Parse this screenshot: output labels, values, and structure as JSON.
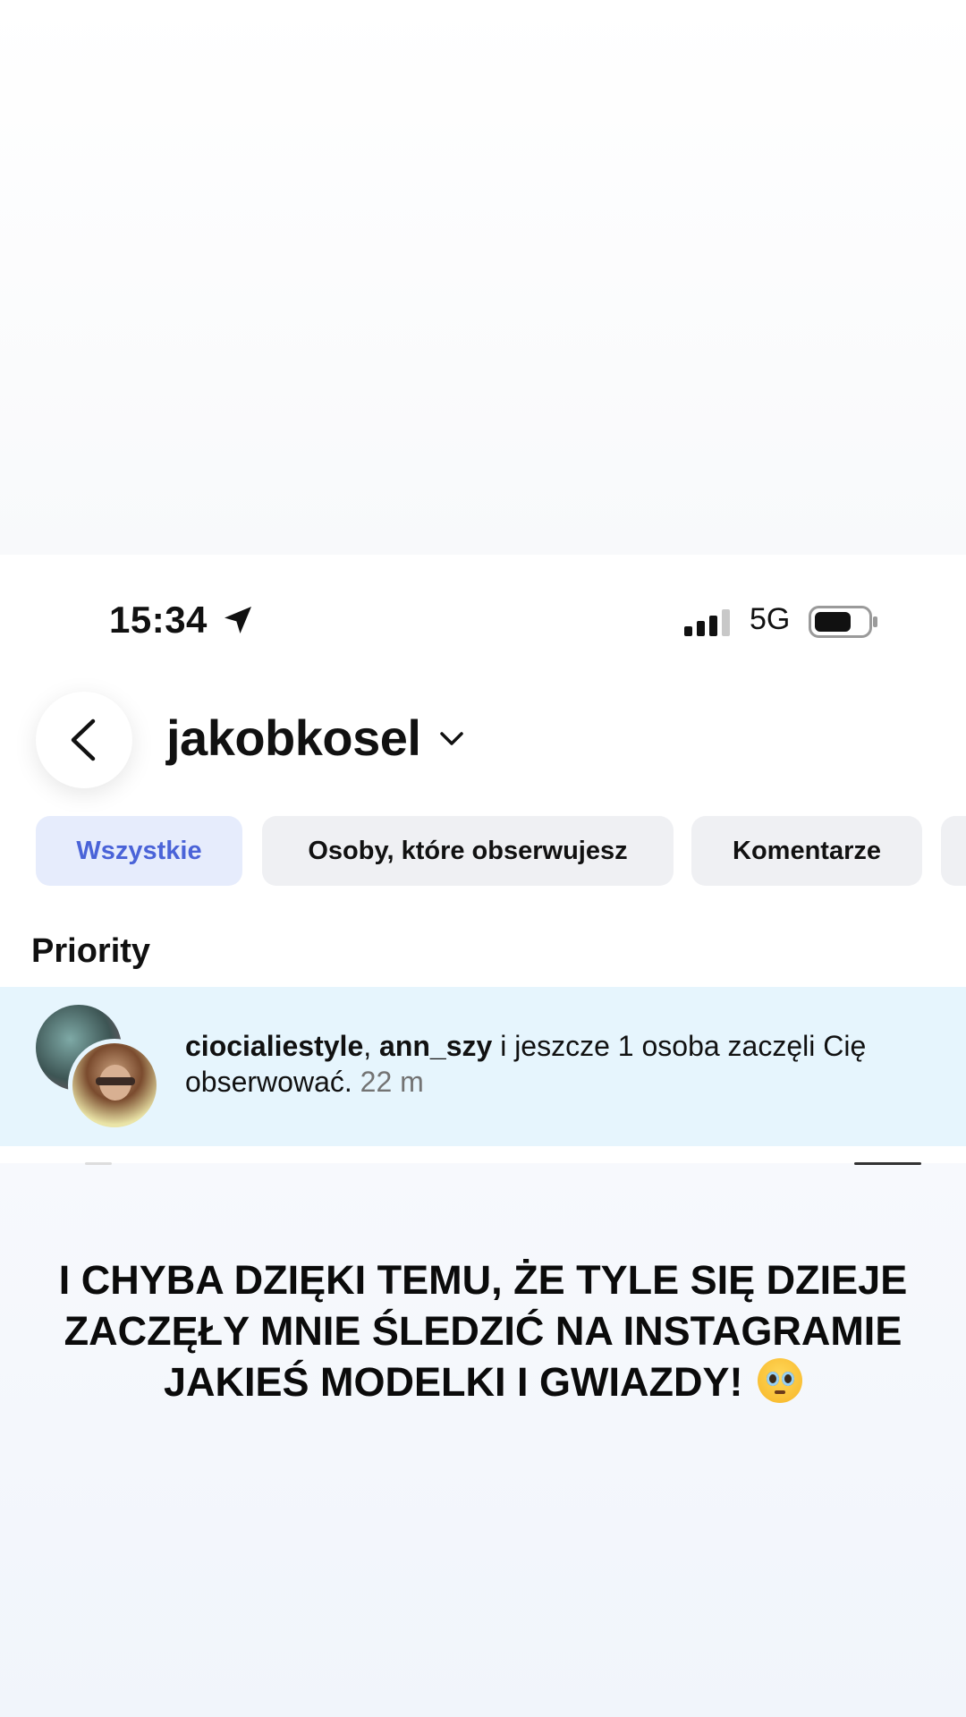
{
  "status_bar": {
    "time": "15:34",
    "network": "5G",
    "location_icon": "location-arrow-icon",
    "signal_icon": "signal-icon",
    "battery_icon": "battery-icon"
  },
  "header": {
    "username": "jakobkosel",
    "back_icon": "chevron-left-icon",
    "dropdown_icon": "chevron-down-icon"
  },
  "tabs": [
    {
      "label": "Wszystkie",
      "active": true
    },
    {
      "label": "Osoby, które obserwujesz",
      "active": false
    },
    {
      "label": "Komentarze",
      "active": false
    }
  ],
  "section": {
    "title": "Priority"
  },
  "notification": {
    "user1": "ciocialiestyle",
    "separator": ", ",
    "user2": "ann_szy",
    "message": " i jeszcze 1 osoba zaczęli Cię obserwować.",
    "time": "22 m"
  },
  "caption": {
    "text": "I CHYBA DZIĘKI TEMU, ŻE TYLE SIĘ DZIEJE ZACZĘŁY MNIE ŚLEDZIĆ NA INSTAGRAMIE JAKIEŚ MODELKI I GWIAZDY!",
    "emoji": "pleading-face-emoji"
  },
  "colors": {
    "active_tab_bg": "#e6ecfc",
    "active_tab_text": "#4a63d8",
    "highlight_row": "#e6f5fd"
  }
}
